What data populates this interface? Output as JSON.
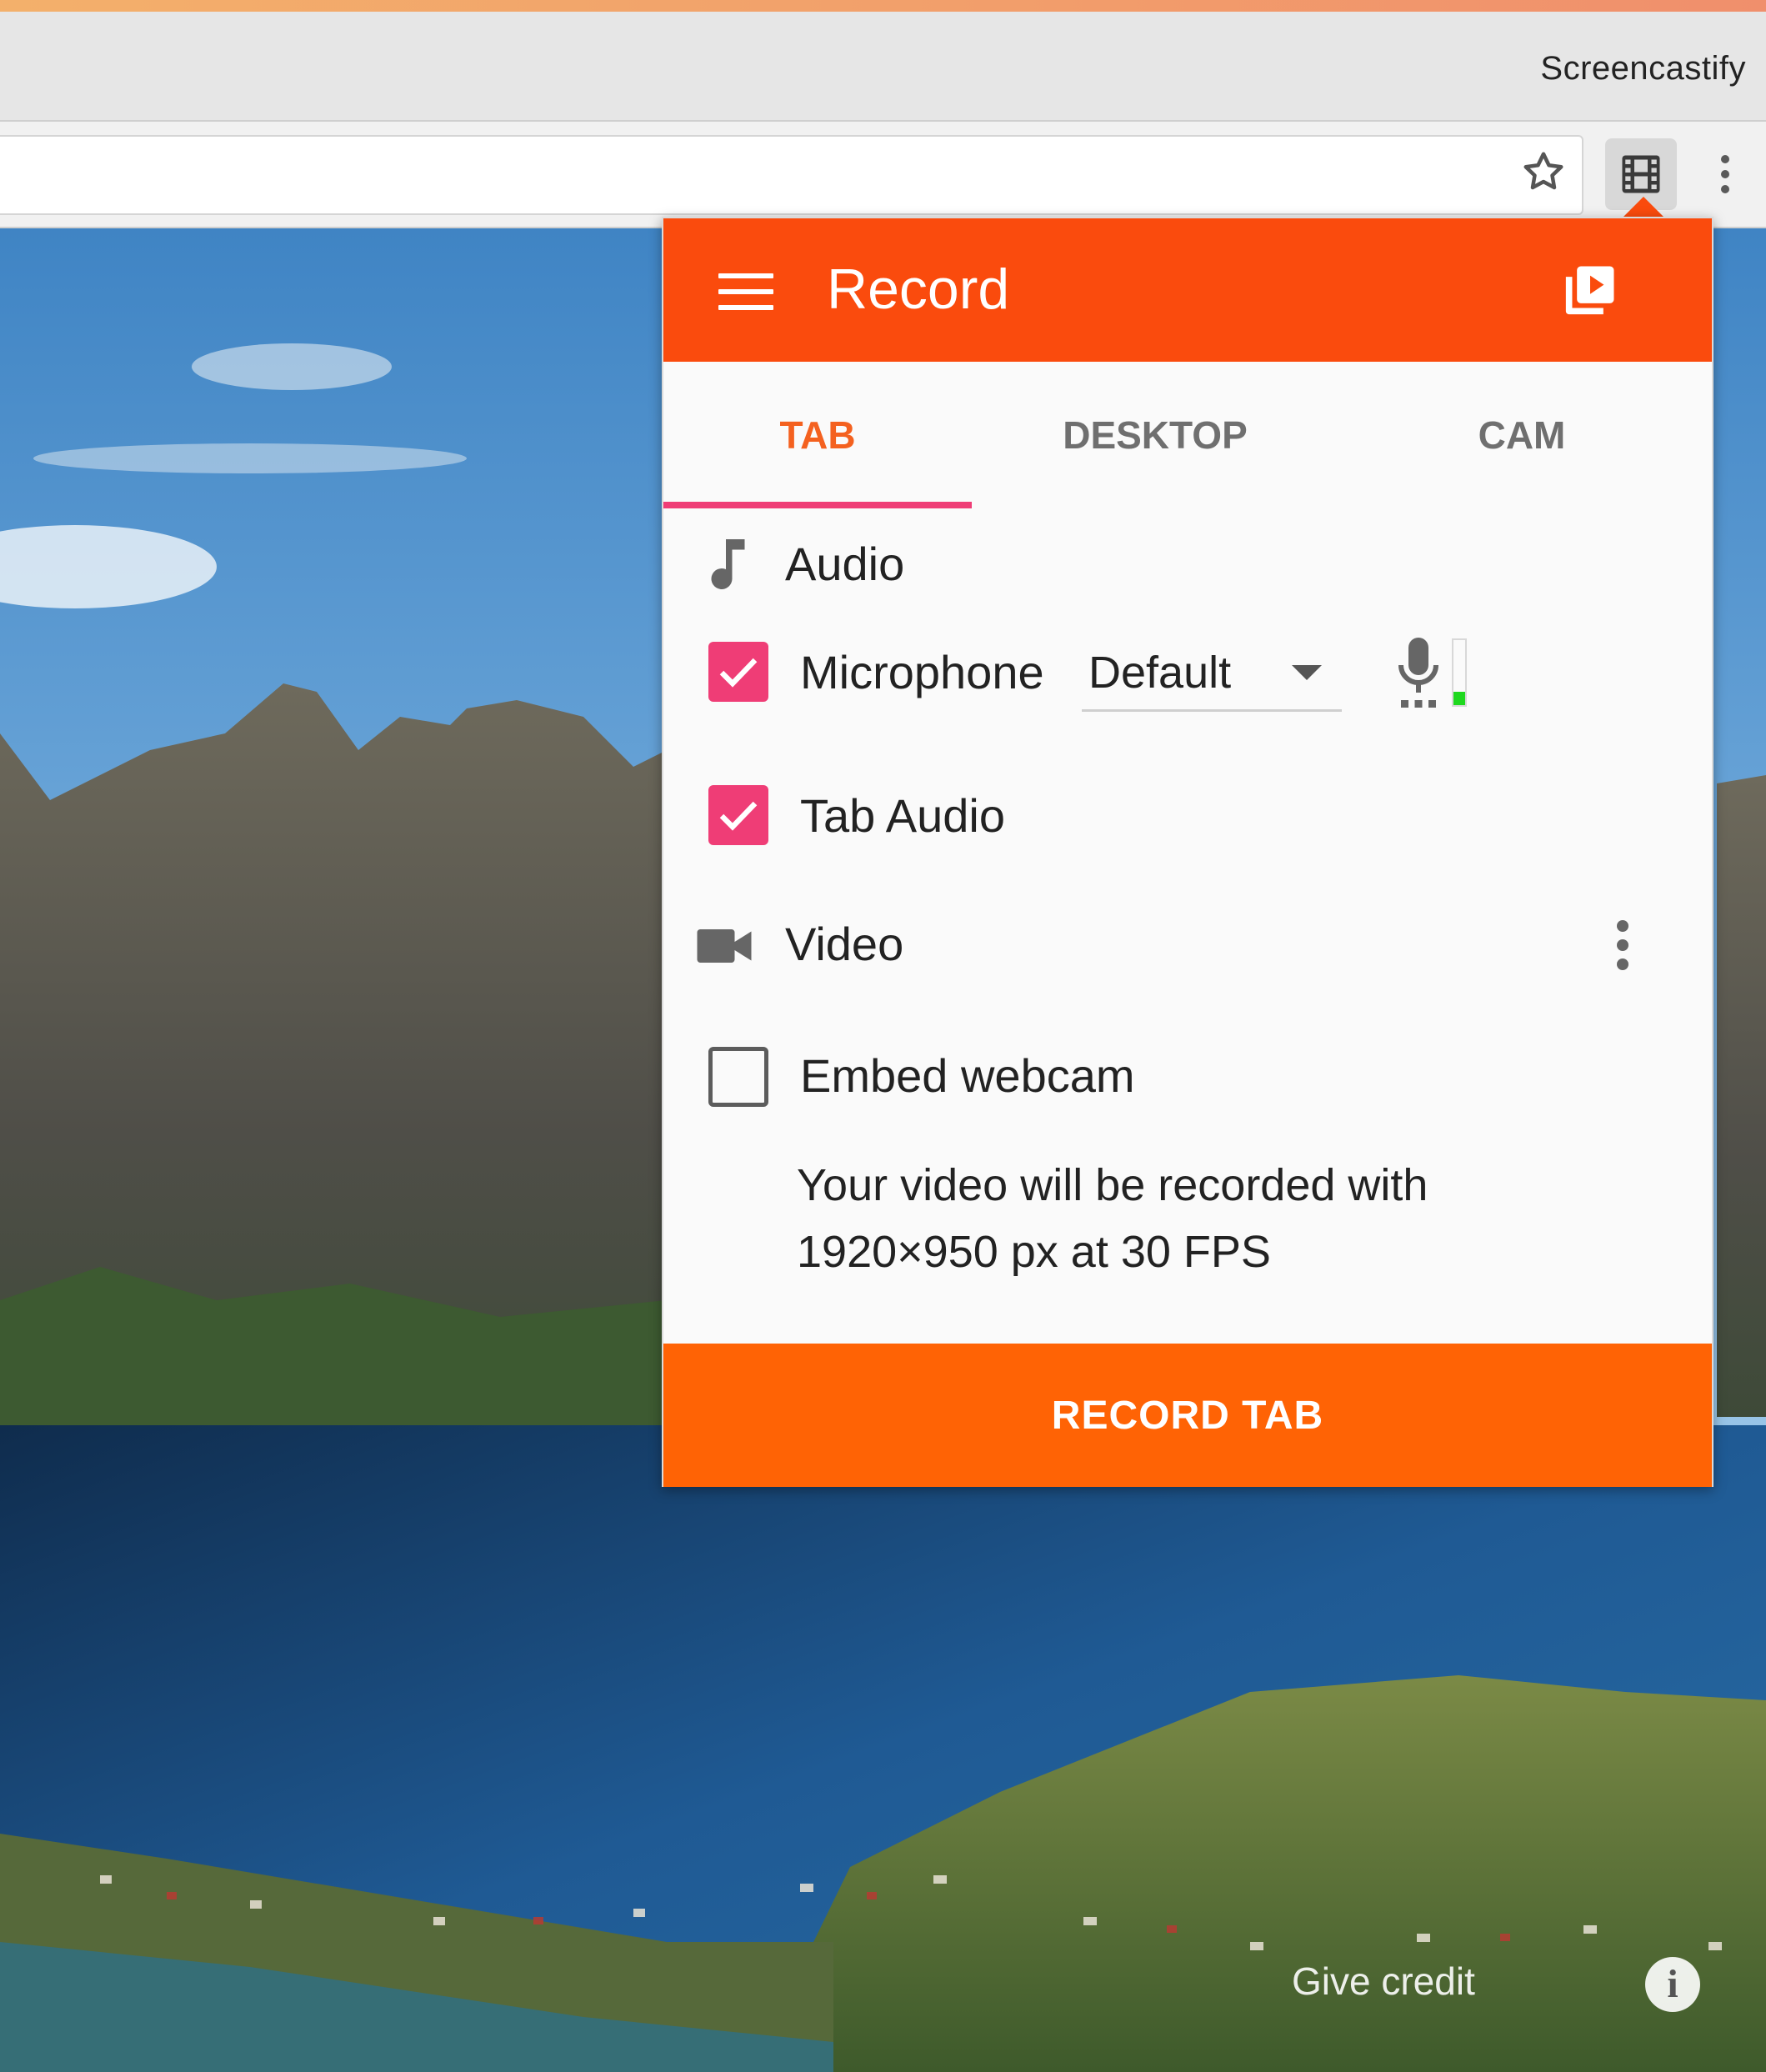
{
  "window": {
    "title": "Screencastify"
  },
  "toolbar": {
    "bookmark_icon": "star-icon",
    "extension_icon": "film-icon",
    "menu_icon": "more-vertical-icon"
  },
  "popup": {
    "title": "Record",
    "header_color": "#fa4b0d",
    "menu_icon": "hamburger-icon",
    "library_icon": "video-library-icon",
    "tabs": [
      {
        "label": "TAB",
        "active": true
      },
      {
        "label": "DESKTOP",
        "active": false
      },
      {
        "label": "CAM",
        "active": false
      }
    ],
    "audio": {
      "section_label": "Audio",
      "section_icon": "music-note-icon",
      "microphone": {
        "label": "Microphone",
        "checked": true,
        "device": "Default",
        "level": 0.2
      },
      "tab_audio": {
        "label": "Tab Audio",
        "checked": true
      }
    },
    "video": {
      "section_label": "Video",
      "section_icon": "videocam-icon",
      "embed_webcam": {
        "label": "Embed webcam",
        "checked": false
      },
      "info_line1": "Your video will be recorded with",
      "info_line2": "1920×950 px at 30 FPS"
    },
    "record_button": {
      "label": "RECORD TAB",
      "color": "#ff6305"
    },
    "accent_color": "#ef3d76"
  },
  "background": {
    "credit_label": "Give credit",
    "info_label": "i"
  }
}
